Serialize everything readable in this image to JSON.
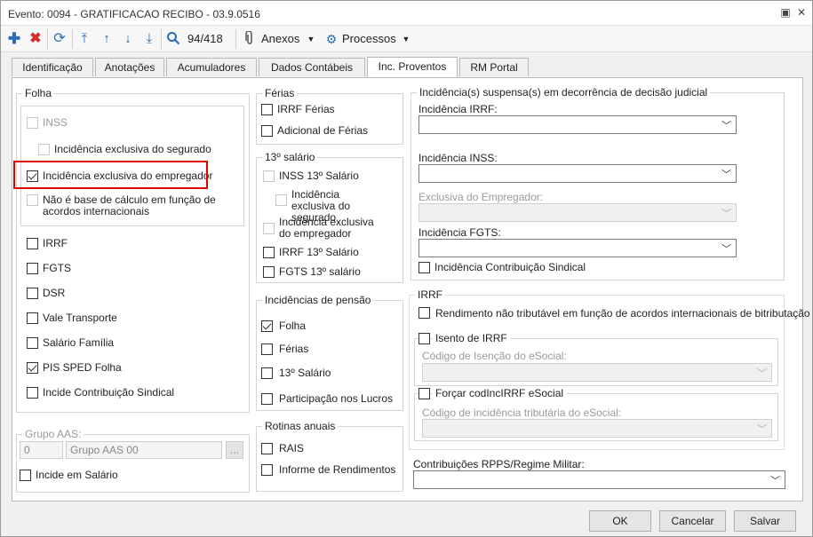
{
  "window": {
    "title": "Evento: 0094 - GRATIFICACAO RECIBO - 03.9.0516",
    "restore": "▣",
    "close": "✕"
  },
  "toolbar": {
    "counter": "94/418",
    "anexos": "Anexos",
    "processos": "Processos"
  },
  "tabs": [
    "Identificação",
    "Anotações",
    "Acumuladores",
    "Dados Contábeis",
    "Inc. Proventos",
    "RM Portal"
  ],
  "folha": {
    "legend": "Folha",
    "inss": "INSS",
    "inc_segurado": "Incidência exclusiva do segurado",
    "inc_empregador": "Incidência exclusiva do empregador",
    "nao_base": "Não é base de cálculo em função de acordos internacionais",
    "irrf": "IRRF",
    "fgts": "FGTS",
    "dsr": "DSR",
    "vale": "Vale Transporte",
    "salario_familia": "Salário Família",
    "pis": "PIS SPED Folha",
    "sindical": "Incide Contribuição Sindical"
  },
  "grupo": {
    "legend": "Grupo AAS:",
    "code": "0",
    "name": "Grupo AAS 00",
    "btn": "...",
    "incide_salario": "Incide em Salário"
  },
  "ferias": {
    "legend": "Férias",
    "irrf": "IRRF Férias",
    "adicional": "Adicional de Férias"
  },
  "decimo": {
    "legend": "13º salário",
    "inss": "INSS 13º Salário",
    "inc_segurado": "Incidência exclusiva do segurado",
    "inc_empregador": "Incidência exclusiva do empregador",
    "irrf": "IRRF 13º Salário",
    "fgts": "FGTS 13º salário"
  },
  "pensao": {
    "legend": "Incidências de pensão",
    "folha": "Folha",
    "ferias": "Férias",
    "decimo": "13º Salário",
    "plr": "Participação nos Lucros"
  },
  "rotinas": {
    "legend": "Rotinas anuais",
    "rais": "RAIS",
    "informe": "Informe de Rendimentos"
  },
  "judicial": {
    "legend": "Incidência(s) suspensa(s) em decorrência de decisão judicial",
    "irrf": "Incidência IRRF:",
    "inss": "Incidência INSS:",
    "exclusiva": "Exclusiva do Empregador:",
    "fgts": "Incidência FGTS:",
    "sindical": "Incidência Contribuição Sindical"
  },
  "irrf": {
    "legend": "IRRF",
    "rendimento": "Rendimento não tributável em função de acordos internacionais de bitributação",
    "isento": "Isento de IRRF",
    "codigo_isencao": "Código de Isenção do eSocial:",
    "forcar": "Forçar codIncIRRF eSocial",
    "codigo_incidencia": "Código de incidência tributária do eSocial:"
  },
  "rpps": {
    "label": "Contribuições RPPS/Regime Militar:"
  },
  "buttons": {
    "ok": "OK",
    "cancelar": "Cancelar",
    "salvar": "Salvar"
  },
  "colors": {
    "accent": "#2a6ebb",
    "delete": "#d03030",
    "highlight": "#e00000"
  }
}
